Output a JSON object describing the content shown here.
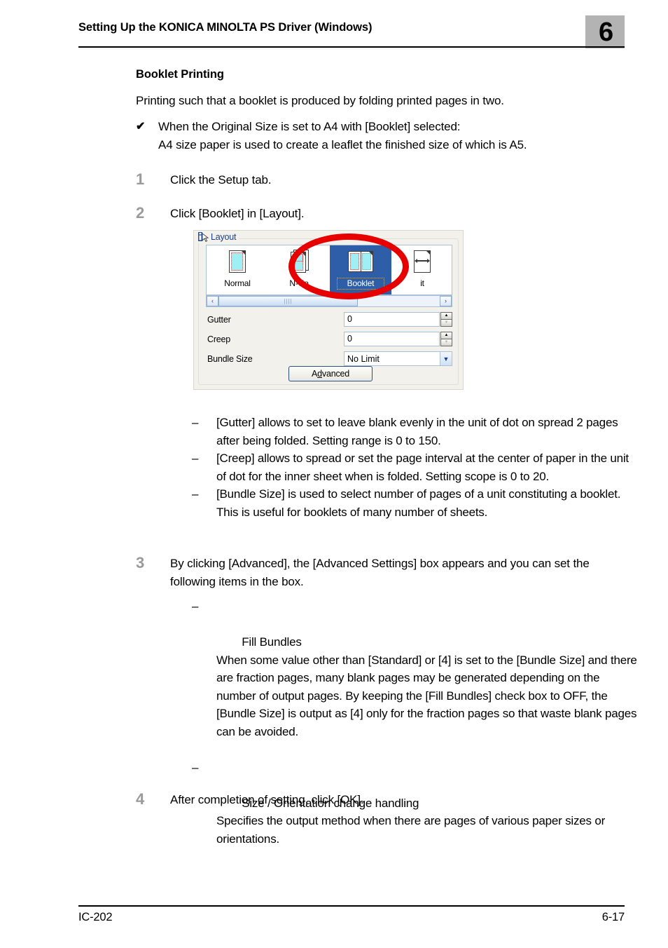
{
  "header": {
    "title": "Setting Up the KONICA MINOLTA PS Driver (Windows)",
    "chapter": "6"
  },
  "section": {
    "heading": "Booklet Printing",
    "intro": "Printing such that a booklet is produced by folding printed pages in two.",
    "note_mark": "✔",
    "note_line1": "When the Original Size is set to A4 with [Booklet] selected:",
    "note_line2": "A4 size paper is used to create a leaflet the finished size of which is A5."
  },
  "steps": [
    {
      "num": "1",
      "text": "Click the Setup tab."
    },
    {
      "num": "2",
      "text": "Click [Booklet] in [Layout]."
    },
    {
      "num": "3",
      "text": "By clicking [Advanced], the [Advanced Settings] box appears and you can set the following items in the box."
    },
    {
      "num": "4",
      "text": "After completion of setting, click [OK]."
    }
  ],
  "bullets_step2": [
    {
      "dash": "–",
      "text": "[Gutter] allows to set to leave blank evenly in the unit of dot on spread 2 pages after being folded. Setting range is 0 to 150."
    },
    {
      "dash": "–",
      "text": "[Creep] allows to spread or set the page interval at the center of paper in the unit of dot for the inner sheet when is folded. Setting scope is 0 to 20."
    },
    {
      "dash": "–",
      "text": "[Bundle Size] is used to select number of pages of a unit constituting a booklet. This is useful for booklets of many number of sheets."
    }
  ],
  "bullets_step3": [
    {
      "dash": "–",
      "text": "Fill Bundles\nWhen some value other than [Standard] or [4] is set to the [Bundle Size] and there are fraction pages, many blank pages may be generated depending on the number of output pages. By keeping the [Fill Bundles] check box to OFF, the [Bundle Size] is output as [4] only for the fraction pages so that waste blank pages can be avoided."
    },
    {
      "dash": "–",
      "text": "Size / Orientation change handling\nSpecifies the output method when there are pages of various paper sizes or orientations."
    }
  ],
  "dialog": {
    "group_title": "Layout",
    "info_icon": "info-icon",
    "gallery": [
      {
        "label": "Normal",
        "selected": false,
        "icon": "page-normal-icon"
      },
      {
        "label": "N-Up",
        "selected": false,
        "icon": "page-nup-icon"
      },
      {
        "label": "Booklet",
        "selected": true,
        "icon": "page-booklet-icon"
      },
      {
        "label": "it",
        "selected": false,
        "icon": "page-split-icon"
      }
    ],
    "scrollbar": {
      "left_arrow": "‹",
      "right_arrow": "›",
      "grip": "||||"
    },
    "fields": [
      {
        "label": "Gutter",
        "value": "0",
        "type": "spinner"
      },
      {
        "label": "Creep",
        "value": "0",
        "type": "spinner"
      },
      {
        "label": "Bundle Size",
        "value": "No Limit",
        "type": "combo"
      }
    ],
    "advanced_button": {
      "pre": "A",
      "accel": "d",
      "post": "vanced"
    },
    "selection_color": "#2f5ea8",
    "annotation_color": "#e60000"
  },
  "footer": {
    "left": "IC-202",
    "right": "6-17"
  }
}
